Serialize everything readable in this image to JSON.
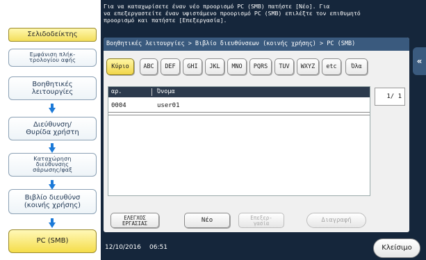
{
  "message": "Για να καταχωρίσετε έναν νέο προορισμό PC (SMB) πατήστε [Νέο]. Για\nνα επεξεργαστείτε έναν υφιστάμενο προορισμό PC (SMB) επιλέξτε τον επιθυμητό\nπροορισμό και πατήστε [Επεξεργασία].",
  "left_panel": {
    "bookmark": "Σελιδοδείκτης",
    "items": [
      "Εμφάνιση πλήκ-\nτρολογίου αφής",
      "Βοηθητικές\nλειτουργίες",
      "Διεύθυνση/\nΘυρίδα χρήστη",
      "Καταχώρηση\nδιεύθυνσης\nσάρωσης/φαξ",
      "Βιβλίο διευθύνσ\n(κοινής χρήσης)",
      "PC (SMB)"
    ]
  },
  "breadcrumb": "Βοηθητικές λειτουργίες > Βιβλίο διευθύνσεων (κοινής χρήσης) > PC (SMB)",
  "tabs": [
    "Κύριο",
    "ABC",
    "DEF",
    "GHI",
    "JKL",
    "MNO",
    "PQRS",
    "TUV",
    "WXYZ",
    "etc",
    "Όλα"
  ],
  "active_tab": "Κύριο",
  "table": {
    "headers": {
      "no": "αρ.",
      "name": "Όνομα"
    },
    "rows": [
      {
        "no": "0004",
        "name": "user01"
      }
    ]
  },
  "pager": "1/  1",
  "buttons": {
    "edit_check": "ΕΛΕΓΧΟΣ\nΕΡΓΑΣΙΑΣ",
    "new": "Νέο",
    "edit": "Επεξερ-\nγασία",
    "delete": "Διαγραφή"
  },
  "status": {
    "date": "12/10/2016",
    "time": "06:51"
  },
  "close": "Κλείσιμο",
  "colors": {
    "accent": "#f3d85a",
    "dark_bg": "#15263b",
    "header": "#3a5a7e"
  }
}
